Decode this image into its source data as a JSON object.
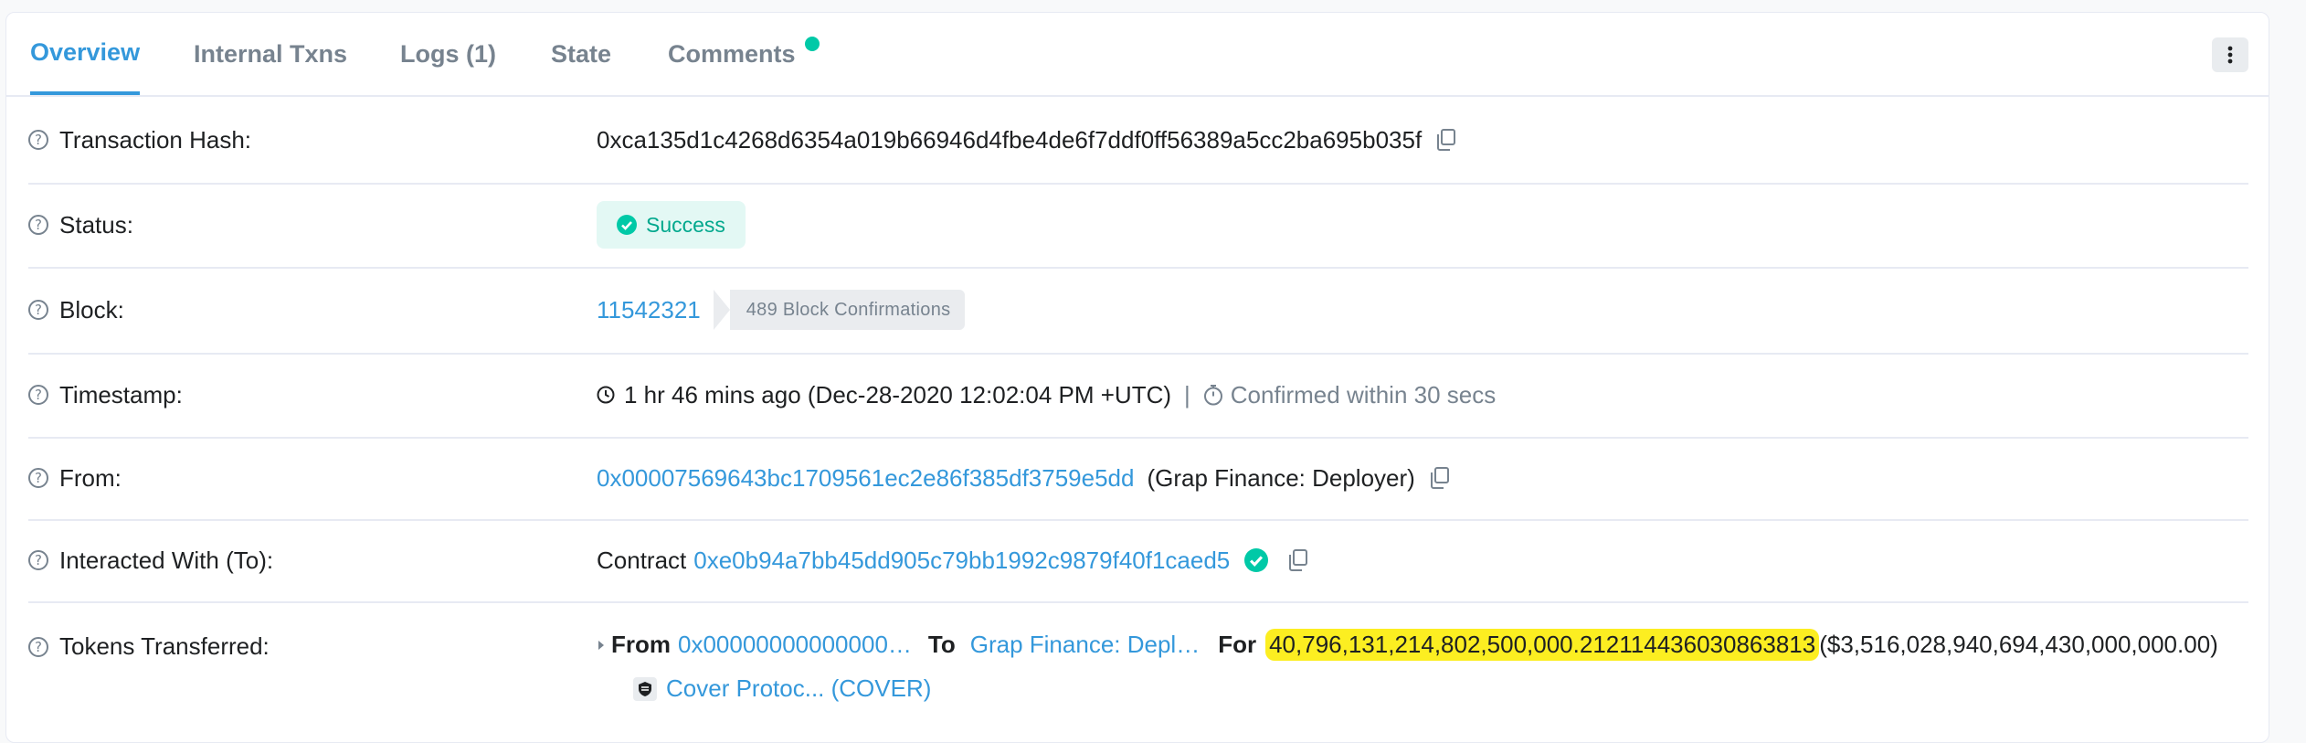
{
  "tabs": [
    {
      "label": "Overview"
    },
    {
      "label": "Internal Txns"
    },
    {
      "label": "Logs (1)"
    },
    {
      "label": "State"
    },
    {
      "label": "Comments"
    }
  ],
  "rows": {
    "tx_hash": {
      "label": "Transaction Hash:",
      "value": "0xca135d1c4268d6354a019b66946d4fbe4de6f7ddf0ff56389a5cc2ba695b035f"
    },
    "status": {
      "label": "Status:",
      "value": "Success"
    },
    "block": {
      "label": "Block:",
      "number": "11542321",
      "confirmations": "489 Block Confirmations"
    },
    "timestamp": {
      "label": "Timestamp:",
      "value": "1 hr 46 mins ago (Dec-28-2020 12:02:04 PM +UTC)",
      "separator": "|",
      "confirmed": "Confirmed within 30 secs"
    },
    "from": {
      "label": "From:",
      "address": "0x00007569643bc1709561ec2e86f385df3759e5dd",
      "name": "(Grap Finance: Deployer)"
    },
    "to": {
      "label": "Interacted With (To):",
      "prefix": "Contract",
      "address": "0xe0b94a7bb45dd905c79bb1992c9879f40f1caed5"
    },
    "tokens": {
      "label": "Tokens Transferred:",
      "from_label": "From",
      "from_value": "0x00000000000000…",
      "to_label": "To",
      "to_value": "Grap Finance: Depl…",
      "for_label": "For",
      "amount": "40,796,131,214,802,500,000.212114436030863813",
      "usd": "($3,516,028,940,694,430,000,000.00)",
      "token_name": "Cover Protoc... (COVER)"
    }
  },
  "colors": {
    "accent": "#3498db",
    "success": "#00c9a7",
    "highlight": "#fcee21"
  }
}
